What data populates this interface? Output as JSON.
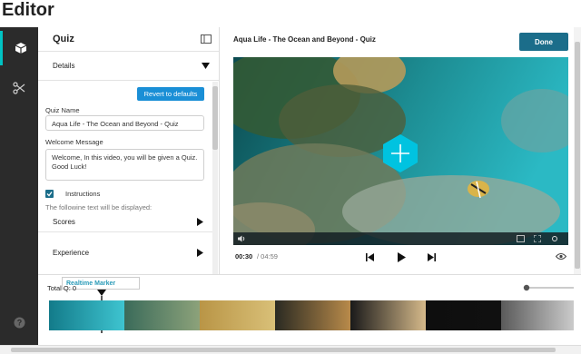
{
  "page": {
    "title": "Editor"
  },
  "rail": {
    "items": [
      {
        "icon": "cube-icon",
        "active": true
      },
      {
        "icon": "scissors-icon",
        "active": false
      },
      {
        "icon": "help-icon",
        "active": false
      }
    ]
  },
  "quiz_panel": {
    "title": "Quiz",
    "details_label": "Details",
    "revert_label": "Revert to defaults",
    "quiz_name_label": "Quiz Name",
    "quiz_name_value": "Aqua Life - The Ocean and Beyond - Quiz",
    "welcome_label": "Welcome Message",
    "welcome_value": "Welcome, In this video, you will be given a Quiz. Good Luck!",
    "instructions_label": "Instructions",
    "instructions_checked": true,
    "instructions_text": "The followine text will be displayed:",
    "scores_label": "Scores",
    "experience_label": "Experience"
  },
  "player": {
    "video_title": "Aqua Life - The Ocean and Beyond - Quiz",
    "done_label": "Done",
    "current_time": "00:30",
    "duration": "/ 04:59"
  },
  "timeline": {
    "realtime_marker_label": "Realtime Marker",
    "total_questions": "Total Q: 0"
  },
  "colors": {
    "accent": "#1b6d8a",
    "button_blue": "#1a8fd6",
    "cyan": "#00c3e0",
    "rail_bg": "#2b2b2b"
  }
}
